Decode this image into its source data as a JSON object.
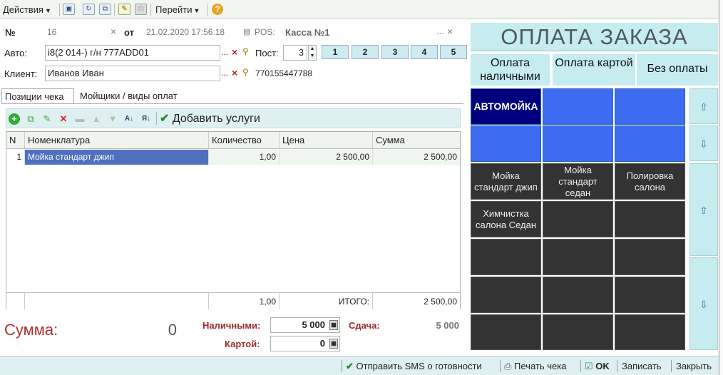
{
  "toolbar": {
    "actions_label": "Действия",
    "goto_label": "Перейти",
    "help_icon": "question-icon"
  },
  "header": {
    "number_label": "№",
    "number_value": "16",
    "from_label": "от",
    "date_value": "21.02.2020 17:56:18",
    "pos_label": "POS:",
    "pos_value": "Касса №1",
    "auto_label": "Авто:",
    "auto_value": "i8(2 014-) г/н 777ADD01",
    "post_label": "Пост:",
    "post_value": "3",
    "post_buttons": [
      "1",
      "2",
      "3",
      "4",
      "5"
    ],
    "client_label": "Клиент:",
    "client_value": "Иванов Иван",
    "client_phone": "770155447788",
    "ellipsis": "...",
    "clear": "×"
  },
  "tabs": [
    "Позиции чека",
    "Мойщики / виды оплат"
  ],
  "items_toolbar": {
    "add_services_label": "Добавить услуги"
  },
  "table": {
    "columns": [
      "N",
      "Номенклатура",
      "Количество",
      "Цена",
      "Сумма"
    ],
    "rows": [
      {
        "n": "1",
        "name": "Мойка стандарт джип",
        "qty": "1,00",
        "price": "2 500,00",
        "sum": "2 500,00"
      }
    ],
    "footer": {
      "qty": "1,00",
      "total_label": "ИТОГО:",
      "sum": "2 500,00"
    }
  },
  "totals": {
    "summa_label": "Сумма:",
    "summa_value": "0",
    "cash_label": "Наличными:",
    "cash_value": "5 000",
    "change_label": "Сдача:",
    "change_value": "5 000",
    "card_label": "Картой:",
    "card_value": "0"
  },
  "bottombar": {
    "sms_label": "Отправить SMS о готовности",
    "print_label": "Печать чека",
    "ok_label": "OK",
    "save_label": "Записать",
    "close_label": "Закрыть"
  },
  "payment_panel": {
    "title": "ОПЛАТА ЗАКАЗА",
    "options": [
      "Оплата наличными",
      "Оплата картой",
      "Без оплаты"
    ],
    "categories": [
      "АВТОМОЙКА",
      "",
      "",
      "",
      "",
      ""
    ],
    "services": [
      "Мойка стандарт джип",
      "Мойка стандарт седан",
      "Полировка салона",
      "Химчистка салона Седан",
      "",
      "",
      "",
      "",
      "",
      "",
      "",
      "",
      "",
      "",
      ""
    ]
  },
  "colors": {
    "accent_blue": "#3d6cf2",
    "selected_category": "#00007f",
    "panel_cyan": "#c6ecf0",
    "service_dark": "#333333",
    "summa_red": "#b03030"
  }
}
